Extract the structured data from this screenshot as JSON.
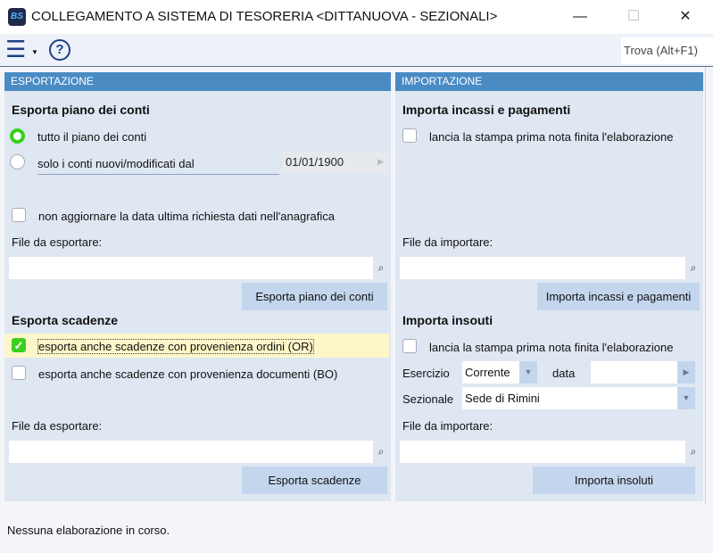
{
  "window": {
    "title": "COLLEGAMENTO A SISTEMA DI TESORERIA <DITTANUOVA - SEZIONALI>",
    "logo": "BS",
    "minimize": "—",
    "maximize": "☐",
    "close": "✕"
  },
  "toolbar": {
    "menu_icon": "☰",
    "help_icon": "?",
    "find": "Trova (Alt+F1)"
  },
  "export": {
    "header": "ESPORTAZIONE",
    "piano_title": "Esporta piano dei conti",
    "radio_all": "tutto il piano dei conti",
    "radio_new": "solo i conti nuovi/modificati dal",
    "date": "01/01/1900",
    "no_update": "non aggiornare la data ultima richiesta dati nell'anagrafica",
    "file_label": "File da esportare:",
    "file_value": "",
    "btn_piano": "Esporta piano dei conti",
    "scad_title": "Esporta scadenze",
    "scad_or": "esporta anche scadenze con provenienza ordini (OR)",
    "scad_bo": "esporta anche scadenze con provenienza documenti (BO)",
    "file_label2": "File da esportare:",
    "file_value2": "",
    "btn_scad": "Esporta scadenze"
  },
  "import": {
    "header": "IMPORTAZIONE",
    "inc_title": "Importa incassi e pagamenti",
    "inc_print": "lancia la stampa prima nota finita l'elaborazione",
    "file_label": "File da importare:",
    "file_value": "",
    "btn_inc": "Importa incassi e pagamenti",
    "ins_title": "Importa insouti",
    "ins_print": "lancia la stampa prima nota finita l'elaborazione",
    "esercizio_label": "Esercizio",
    "esercizio_value": "Corrente",
    "data_label": "data",
    "data_value": "",
    "sezionale_label": "Sezionale",
    "sezionale_value": "Sede di Rimini",
    "file_label2": "File da importare:",
    "file_value2": "",
    "btn_ins": "Importa insoluti"
  },
  "status": "Nessuna elaborazione in corso."
}
